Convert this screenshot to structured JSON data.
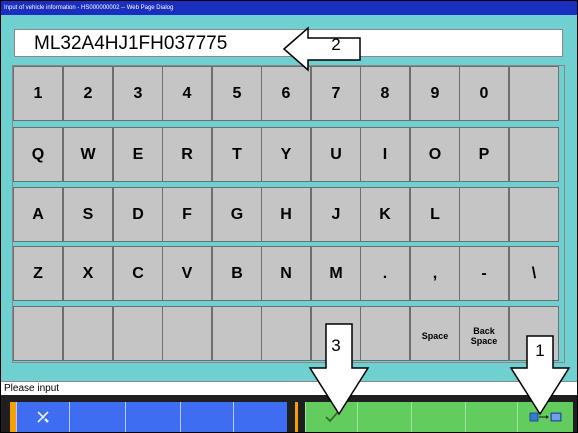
{
  "window": {
    "title": "Input of vehicle information - HS000000002 -- Web Page Dialog"
  },
  "vin_field": {
    "value": "ML32A4HJ1FH037775"
  },
  "keyboard": {
    "rows": [
      [
        "1",
        "2",
        "3",
        "4",
        "5",
        "6",
        "7",
        "8",
        "9",
        "0",
        ""
      ],
      [
        "Q",
        "W",
        "E",
        "R",
        "T",
        "Y",
        "U",
        "I",
        "O",
        "P",
        ""
      ],
      [
        "A",
        "S",
        "D",
        "F",
        "G",
        "H",
        "J",
        "K",
        "L",
        "",
        ""
      ],
      [
        "Z",
        "X",
        "C",
        "V",
        "B",
        "N",
        "M",
        ".",
        ",",
        "-",
        "\\"
      ],
      [
        "",
        "",
        "",
        "",
        "",
        "",
        "",
        "",
        "Space",
        "Back\nSpace",
        ""
      ]
    ]
  },
  "status": {
    "text": "Please input"
  },
  "callouts": {
    "c1": "1",
    "c2": "2",
    "c3": "3"
  },
  "taskbar": {
    "left_icon": "tools-icon",
    "ok_icon": "checkmark-icon",
    "confirm_icon": "data-transfer-icon"
  },
  "colors": {
    "background": "#6ed0d0",
    "title_bar": "#1a2fc0",
    "key": "#c5c5c5",
    "task_blue": "#3f6df2",
    "task_green": "#62cc5e",
    "accent_orange": "#f5a000"
  }
}
